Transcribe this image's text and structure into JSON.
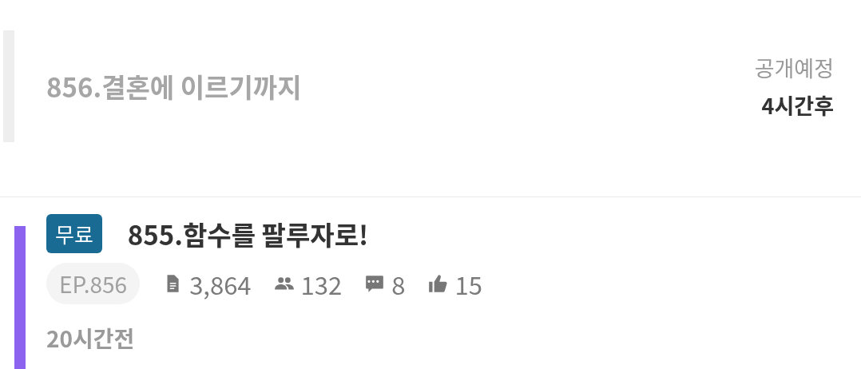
{
  "episodes": [
    {
      "kind": "upcoming",
      "title": "856.결혼에 이르기까지",
      "release_label": "공개예정",
      "release_time": "4시간후"
    },
    {
      "kind": "released",
      "badge": "무료",
      "title": "855.함수를 팔루자로!",
      "episode_number": "EP.856",
      "stats": [
        {
          "kind": "views",
          "value": "3,864"
        },
        {
          "kind": "readers",
          "value": "132"
        },
        {
          "kind": "comments",
          "value": "8"
        },
        {
          "kind": "likes",
          "value": "15"
        }
      ],
      "time_ago": "20시간전"
    }
  ]
}
